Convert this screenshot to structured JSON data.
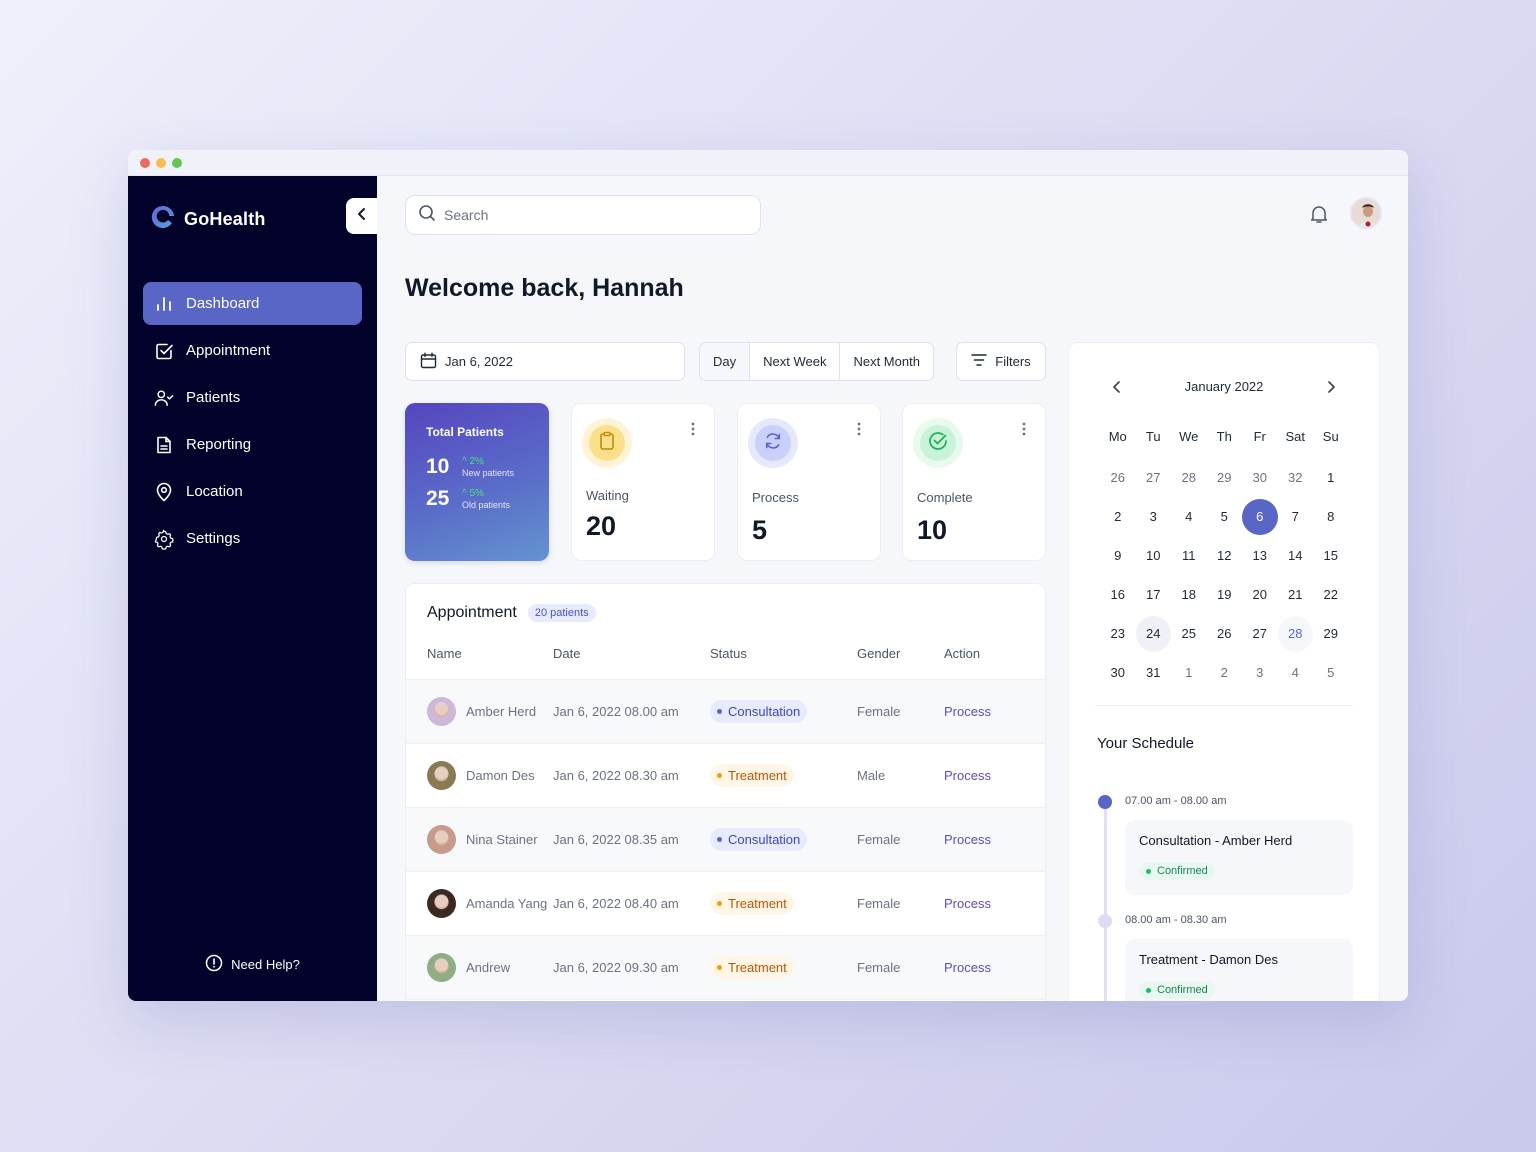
{
  "window": {
    "traffic_lights": [
      "#ee6a5f",
      "#f5be4f",
      "#62c554"
    ]
  },
  "sidebar": {
    "brand": "GoHealth",
    "collapse_icon": "chevron-left-icon",
    "items": [
      {
        "label": "Dashboard",
        "icon": "bar-chart-icon",
        "active": true
      },
      {
        "label": "Appointment",
        "icon": "checkbox-icon",
        "active": false
      },
      {
        "label": "Patients",
        "icon": "user-check-icon",
        "active": false
      },
      {
        "label": "Reporting",
        "icon": "document-icon",
        "active": false
      },
      {
        "label": "Location",
        "icon": "map-pin-icon",
        "active": false
      },
      {
        "label": "Settings",
        "icon": "gear-icon",
        "active": false
      }
    ],
    "help_label": "Need Help?"
  },
  "header": {
    "search_placeholder": "Search",
    "search_value": ""
  },
  "welcome": "Welcome back, Hannah",
  "toolbar": {
    "date": "Jan 6, 2022",
    "ranges": [
      {
        "label": "Day",
        "active": true
      },
      {
        "label": "Next Week",
        "active": false
      },
      {
        "label": "Next Month",
        "active": false
      }
    ],
    "filters_label": "Filters"
  },
  "stats": {
    "total": {
      "title": "Total Patients",
      "rows": [
        {
          "value": "10",
          "change": "2%",
          "label": "New patients"
        },
        {
          "value": "25",
          "change": "5%",
          "label": "Old patients"
        }
      ]
    },
    "cards": [
      {
        "label": "Waiting",
        "value": "20",
        "icon": "clipboard-icon",
        "color": "#d9a520",
        "ring": "#fef3d6",
        "inner": "#fbe08c"
      },
      {
        "label": "Process",
        "value": "5",
        "icon": "refresh-icon",
        "color": "#5a66c6",
        "ring": "#e6e9fb",
        "inner": "#c9d0fb"
      },
      {
        "label": "Complete",
        "value": "10",
        "icon": "check-circle-icon",
        "color": "#21b35d",
        "ring": "#e8faee",
        "inner": "#c9f3d8"
      }
    ]
  },
  "appointments": {
    "title": "Appointment",
    "count_badge": "20 patients",
    "columns": [
      "Name",
      "Date",
      "Status",
      "Gender",
      "Action"
    ],
    "rows": [
      {
        "name": "Amber Herd",
        "date": "Jan 6, 2022 08.00 am",
        "status": "Consultation",
        "gender": "Female",
        "action": "Process",
        "avatar": "#cdb8d9"
      },
      {
        "name": "Damon Des",
        "date": "Jan 6, 2022 08.30 am",
        "status": "Treatment",
        "gender": "Male",
        "action": "Process",
        "avatar": "#8a7a52"
      },
      {
        "name": "Nina Stainer",
        "date": "Jan 6, 2022 08.35 am",
        "status": "Consultation",
        "gender": "Female",
        "action": "Process",
        "avatar": "#c79a8c"
      },
      {
        "name": "Amanda Yang",
        "date": "Jan 6, 2022 08.40 am",
        "status": "Treatment",
        "gender": "Female",
        "action": "Process",
        "avatar": "#3b2a22"
      },
      {
        "name": "Andrew",
        "date": "Jan 6, 2022 09.30 am",
        "status": "Treatment",
        "gender": "Female",
        "action": "Process",
        "avatar": "#8fae85"
      }
    ],
    "status_styles": {
      "Consultation": {
        "bg": "#e7ebfd",
        "fg": "#3f48b5",
        "dot": "#5a66c6"
      },
      "Treatment": {
        "bg": "#fff6e6",
        "fg": "#c2540a",
        "dot": "#f59e0b"
      }
    }
  },
  "calendar": {
    "month_label": "January 2022",
    "weekdays": [
      "Mo",
      "Tu",
      "We",
      "Th",
      "Fr",
      "Sat",
      "Su"
    ],
    "days": [
      {
        "d": "26",
        "m": true
      },
      {
        "d": "27",
        "m": true
      },
      {
        "d": "28",
        "m": true
      },
      {
        "d": "29",
        "m": true
      },
      {
        "d": "30",
        "m": true
      },
      {
        "d": "32",
        "m": true
      },
      {
        "d": "1"
      },
      {
        "d": "2"
      },
      {
        "d": "3"
      },
      {
        "d": "4"
      },
      {
        "d": "5"
      },
      {
        "d": "6",
        "sel": true
      },
      {
        "d": "7"
      },
      {
        "d": "8"
      },
      {
        "d": "9"
      },
      {
        "d": "10"
      },
      {
        "d": "11"
      },
      {
        "d": "12"
      },
      {
        "d": "13"
      },
      {
        "d": "14"
      },
      {
        "d": "15"
      },
      {
        "d": "16"
      },
      {
        "d": "17"
      },
      {
        "d": "18"
      },
      {
        "d": "19"
      },
      {
        "d": "20"
      },
      {
        "d": "21"
      },
      {
        "d": "22"
      },
      {
        "d": "23"
      },
      {
        "d": "24",
        "hl": true
      },
      {
        "d": "25"
      },
      {
        "d": "26"
      },
      {
        "d": "27"
      },
      {
        "d": "28",
        "hov": true
      },
      {
        "d": "29"
      },
      {
        "d": "30"
      },
      {
        "d": "31"
      },
      {
        "d": "1",
        "m": true
      },
      {
        "d": "2",
        "m": true
      },
      {
        "d": "3",
        "m": true
      },
      {
        "d": "4",
        "m": true
      },
      {
        "d": "5",
        "m": true
      }
    ]
  },
  "schedule": {
    "title": "Your Schedule",
    "items": [
      {
        "time": "07.00 am -  08.00 am",
        "title": "Consultation - Amber Herd",
        "status": "Confirmed",
        "active": true
      },
      {
        "time": "08.00 am -  08.30 am",
        "title": "Treatment - Damon Des",
        "status": "Confirmed",
        "active": false
      }
    ]
  }
}
